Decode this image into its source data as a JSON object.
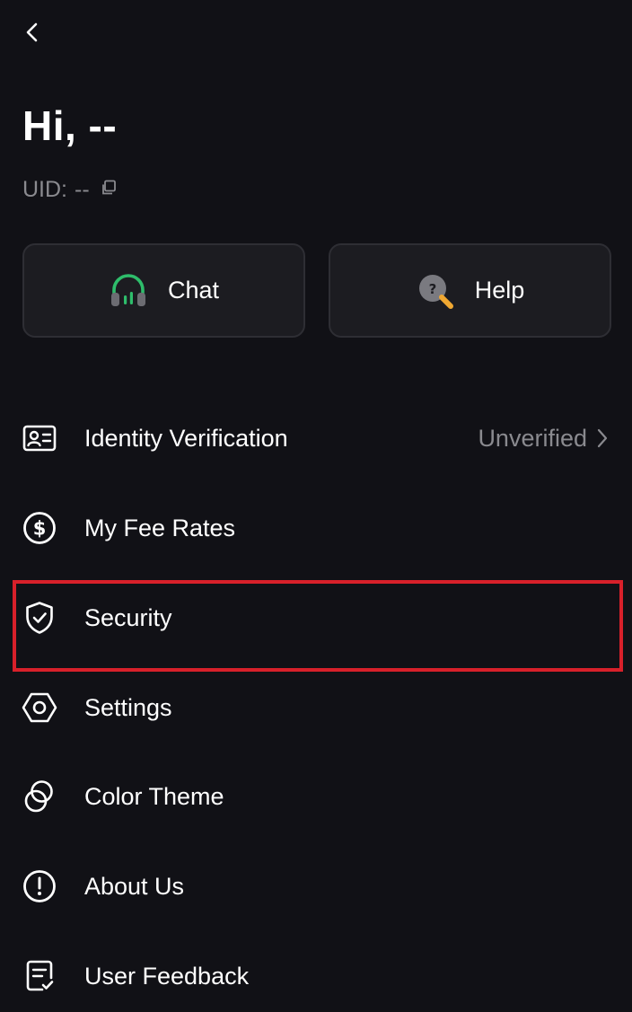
{
  "header": {
    "back_icon": "chevron-left-icon",
    "greeting": "Hi, --",
    "uid_label": "UID:",
    "uid_value": "--",
    "copy_icon": "copy-icon"
  },
  "actions": [
    {
      "label": "Chat",
      "icon": "headset-icon",
      "accent": "#2ebd6b"
    },
    {
      "label": "Help",
      "icon": "help-search-icon",
      "accent": "#f0a832"
    }
  ],
  "menu": [
    {
      "label": "Identity Verification",
      "icon": "id-card-icon",
      "status": "Unverified"
    },
    {
      "label": "My Fee Rates",
      "icon": "dollar-circle-icon"
    },
    {
      "label": "Security",
      "icon": "shield-check-icon",
      "highlighted": true
    },
    {
      "label": "Settings",
      "icon": "hexagon-settings-icon"
    },
    {
      "label": "Color Theme",
      "icon": "overlapping-circles-icon"
    },
    {
      "label": "About Us",
      "icon": "exclamation-circle-icon"
    },
    {
      "label": "User Feedback",
      "icon": "feedback-document-icon"
    }
  ],
  "colors": {
    "background": "#111116",
    "card": "#1c1c21",
    "text": "#ffffff",
    "muted": "#8a8a8f",
    "highlight": "#d8202a"
  }
}
